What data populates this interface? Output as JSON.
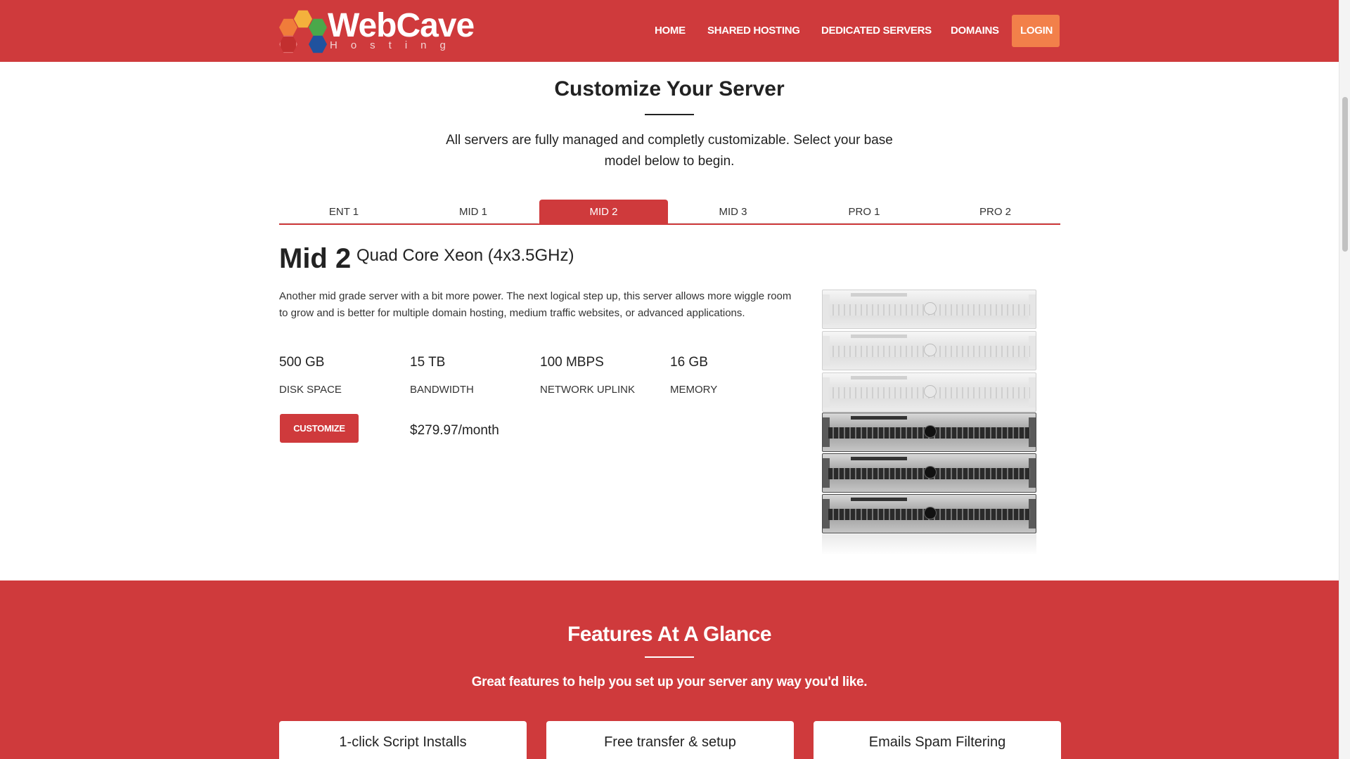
{
  "header": {
    "logo_title": "WebCave",
    "logo_subtitle": "Hosting",
    "nav": [
      {
        "label": "HOME"
      },
      {
        "label": "SHARED HOSTING"
      },
      {
        "label": "DEDICATED SERVERS"
      },
      {
        "label": "DOMAINS"
      },
      {
        "label": "LOGIN"
      }
    ],
    "colors": {
      "brand": "#cf3a3c",
      "login": "#f2804a"
    }
  },
  "customize": {
    "title": "Customize Your Server",
    "description": "All servers are fully managed and completly customizable. Select your base model below to begin.",
    "tabs": [
      {
        "label": "ENT 1"
      },
      {
        "label": "MID 1"
      },
      {
        "label": "MID 2"
      },
      {
        "label": "MID 3"
      },
      {
        "label": "PRO 1"
      },
      {
        "label": "PRO 2"
      }
    ],
    "active_tab": "MID 2"
  },
  "plan": {
    "name": "Mid 2",
    "cpu": "Quad Core Xeon (4x3.5GHz)",
    "description": "Another mid grade server with a bit more power. The next logical step up, this server allows more wiggle room to grow and is better for multiple domain hosting, medium traffic websites, or advanced applications.",
    "specs": [
      {
        "value": "500 GB",
        "label": "DISK SPACE"
      },
      {
        "value": "15 TB",
        "label": "BANDWIDTH"
      },
      {
        "value": "100 MBPS",
        "label": "NETWORK UPLINK"
      },
      {
        "value": "16 GB",
        "label": "MEMORY"
      }
    ],
    "customize_label": "CUSTOMIZE",
    "price": "$279.97/month"
  },
  "features": {
    "title": "Features At A Glance",
    "subtitle": "Great features to help you set up your server any way you'd like.",
    "cards": [
      {
        "label": "1-click Script Installs"
      },
      {
        "label": "Free transfer & setup"
      },
      {
        "label": "Emails Spam Filtering"
      }
    ]
  }
}
